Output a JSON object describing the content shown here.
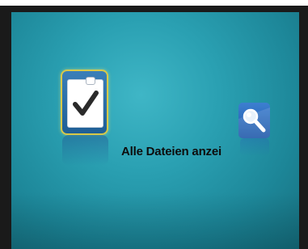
{
  "menu": {
    "current_item_label": "Alle Dateien anzei",
    "items": [
      {
        "icon": "checklist-clipboard-icon",
        "selected": true
      },
      {
        "icon": "search-magnifier-icon",
        "selected": false
      }
    ]
  },
  "colors": {
    "background": "#2aa0b2",
    "selection_border": "#d8c948",
    "tile_blue": "#1f5f96",
    "label_text": "#0d0d0d"
  }
}
